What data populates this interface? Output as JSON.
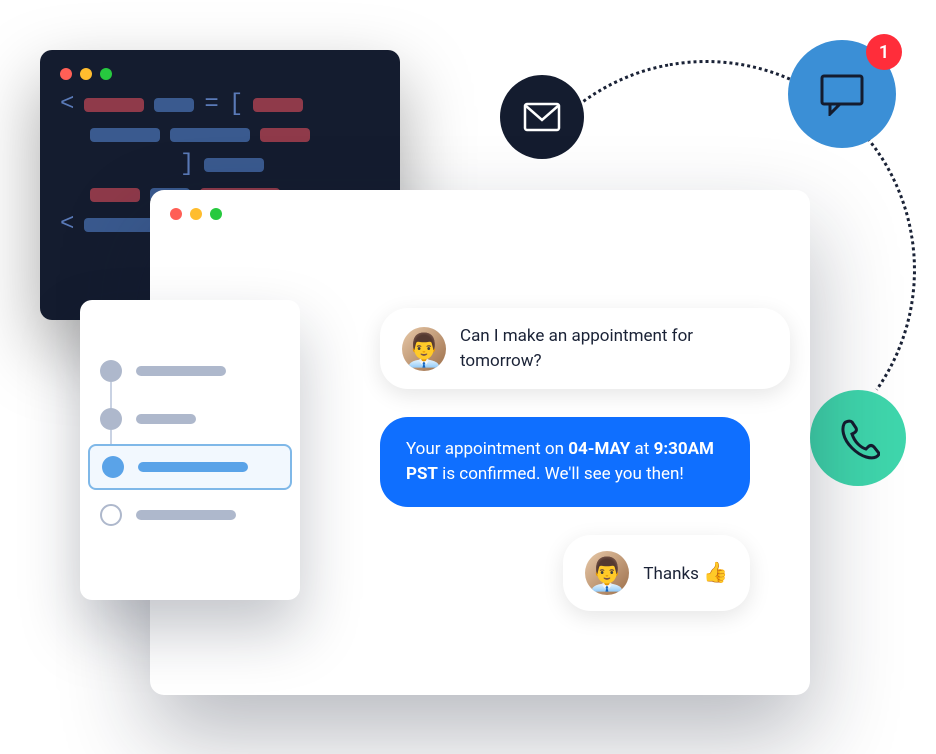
{
  "arc": {
    "mail_icon": "mail-icon",
    "chat_icon": "chat-icon",
    "phone_icon": "phone-icon",
    "notification_count": "1"
  },
  "chat": {
    "messages": [
      {
        "role": "incoming",
        "text": "Can I make an appointment for tomorrow?"
      },
      {
        "role": "outgoing",
        "prefix": "Your appointment on ",
        "date": "04-MAY",
        "mid": " at ",
        "time": "9:30AM PST",
        "suffix": " is confirmed. We'll see you then!"
      },
      {
        "role": "incoming",
        "text": "Thanks",
        "emoji": "👍"
      }
    ]
  },
  "colors": {
    "accent_blue": "#0f6fff",
    "chat_circle": "#3b8fd6",
    "phone_circle": "#3fd6ac",
    "notif_red": "#ff2d3a",
    "dark": "#141c2f"
  }
}
